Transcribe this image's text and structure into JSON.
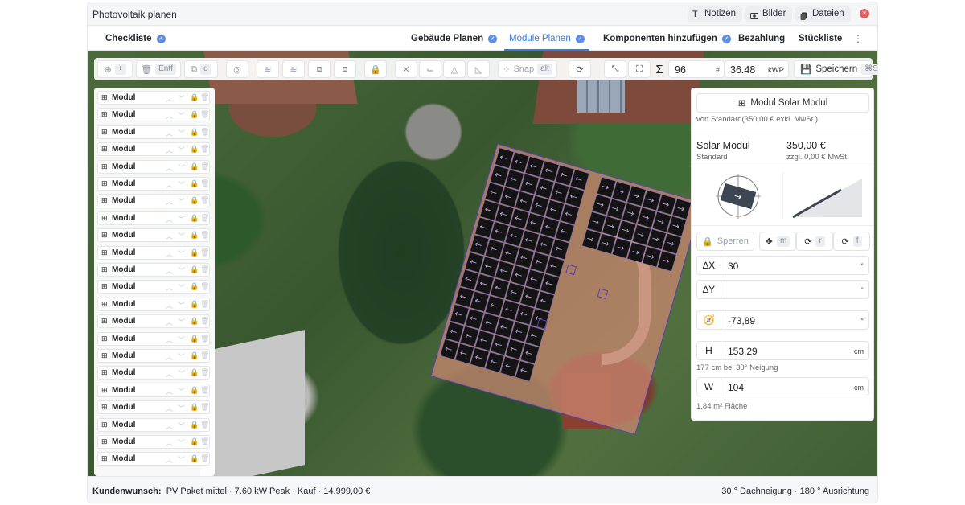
{
  "app": {
    "title": "Photovoltaik planen"
  },
  "titlebar": {
    "notes": "Notizen",
    "images": "Bilder",
    "files": "Dateien"
  },
  "nav": [
    {
      "label": "Checkliste",
      "done": true
    },
    {
      "label": "Gebäude Planen",
      "done": true
    },
    {
      "label": "Module Planen",
      "done": true,
      "active": true
    },
    {
      "label": "Komponenten hinzufügen",
      "done": true
    },
    {
      "label": "Bezahlung",
      "done": false
    },
    {
      "label": "Stückliste",
      "done": false
    }
  ],
  "toolbar": {
    "add_kbd": "+",
    "delete_kbd": "Entf",
    "duplicate_kbd": "d",
    "snap_label": "Snap",
    "snap_kbd": "alt",
    "sum_symbol": "Σ",
    "module_count": "96",
    "count_unit": "#",
    "power": "36.48",
    "power_unit": "kWP",
    "save_label": "Speichern",
    "save_kbd": "⌘S"
  },
  "module_list": {
    "item_label": "Modul",
    "count": 22
  },
  "detail": {
    "module_button": "Modul Solar Modul",
    "standard_price_note": "von Standard(350,00 € exkl. MwSt.)",
    "name": "Solar Modul",
    "variant": "Standard",
    "price": "350,00 €",
    "price_note": "zzgl. 0,00 € MwSt.",
    "lock_label": "Sperren",
    "move_kbd": "m",
    "rotate_kbd": "r",
    "flip_kbd": "f",
    "angle_x_label": "∆X",
    "angle_x_value": "30",
    "angle_y_label": "∆Y",
    "angle_y_value": "",
    "degree_unit": "°",
    "azimuth_value": "-73,89",
    "height_label": "H",
    "height_value": "153,29",
    "height_unit": "cm",
    "height_note": "177 cm bei 30° Neigung",
    "width_label": "W",
    "width_value": "104",
    "width_unit": "cm",
    "area_note": "1.84 m² Fläche"
  },
  "footer": {
    "customer_label": "Kundenwunsch:",
    "package": "PV Paket mittel · 7.60 kW Peak · Kauf · 14.999,00 €",
    "orientation": "30 ° Dachneigung ·  180 ° Ausrichtung"
  },
  "colors": {
    "accent": "#3a7be0",
    "panel": "#141414",
    "panel_arrow": "#b79ad6",
    "roof_area": "#c98770"
  }
}
